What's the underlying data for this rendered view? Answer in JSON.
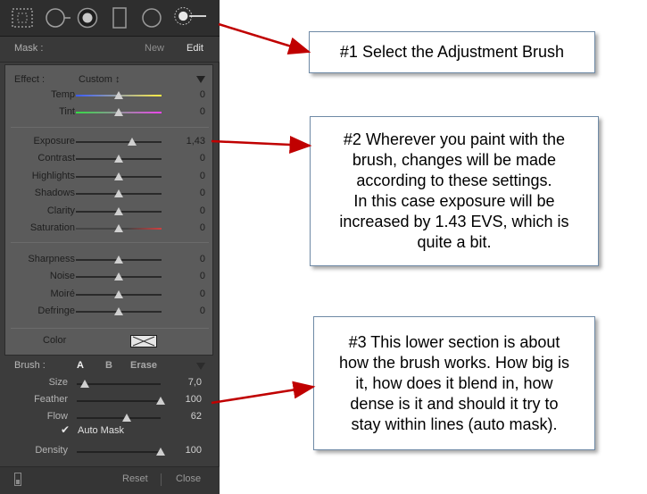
{
  "panel": {
    "mask_label": "Mask :",
    "mask_new": "New",
    "mask_edit": "Edit",
    "effect_label": "Effect :",
    "effect_value": "Custom",
    "effect_arrows": "↕",
    "tools": [
      "crop-overlay-icon",
      "spot-removal-icon",
      "red-eye-icon",
      "graduated-filter-icon",
      "radial-filter-icon",
      "adjustment-brush-icon"
    ],
    "groups": [
      [
        {
          "name": "Temp",
          "value": "0",
          "pos": 0.5,
          "track": "temp"
        },
        {
          "name": "Tint",
          "value": "0",
          "pos": 0.5,
          "track": "tint"
        }
      ],
      [
        {
          "name": "Exposure",
          "value": "1,43",
          "pos": 0.66,
          "track": "plain"
        },
        {
          "name": "Contrast",
          "value": "0",
          "pos": 0.5,
          "track": "plain"
        },
        {
          "name": "Highlights",
          "value": "0",
          "pos": 0.5,
          "track": "plain"
        },
        {
          "name": "Shadows",
          "value": "0",
          "pos": 0.5,
          "track": "plain"
        },
        {
          "name": "Clarity",
          "value": "0",
          "pos": 0.5,
          "track": "plain"
        },
        {
          "name": "Saturation",
          "value": "0",
          "pos": 0.5,
          "track": "saturation"
        }
      ],
      [
        {
          "name": "Sharpness",
          "value": "0",
          "pos": 0.5,
          "track": "plain"
        },
        {
          "name": "Noise",
          "value": "0",
          "pos": 0.5,
          "track": "plain"
        },
        {
          "name": "Moiré",
          "value": "0",
          "pos": 0.5,
          "track": "plain"
        },
        {
          "name": "Defringe",
          "value": "0",
          "pos": 0.5,
          "track": "plain"
        }
      ]
    ],
    "color_label": "Color",
    "brush": {
      "label": "Brush :",
      "a": "A",
      "b": "B",
      "erase": "Erase",
      "sliders": [
        {
          "name": "Size",
          "value": "7,0",
          "pos": 0.1
        },
        {
          "name": "Feather",
          "value": "100",
          "pos": 1.0
        },
        {
          "name": "Flow",
          "value": "62",
          "pos": 0.6
        }
      ],
      "auto_mask": "Auto Mask",
      "auto_mask_check": "✔",
      "density_name": "Density",
      "density_value": "100",
      "density_pos": 1.0
    },
    "reset": "Reset",
    "close": "Close"
  },
  "callouts": [
    {
      "text": "#1 Select the Adjustment Brush"
    },
    {
      "text": "#2 Wherever you paint with the\nbrush, changes will be made\naccording to these settings.\nIn this case exposure will be\nincreased by 1.43 EVS, which is\nquite a bit."
    },
    {
      "text": "#3 This lower section is about\nhow the brush works. How big is\nit, how does it blend in, how\ndense is it and should it try to\nstay within lines (auto mask)."
    }
  ],
  "colors": {
    "arrow": "#c00000",
    "panel": "#3c3c3c",
    "inner": "#5b5b5b"
  }
}
